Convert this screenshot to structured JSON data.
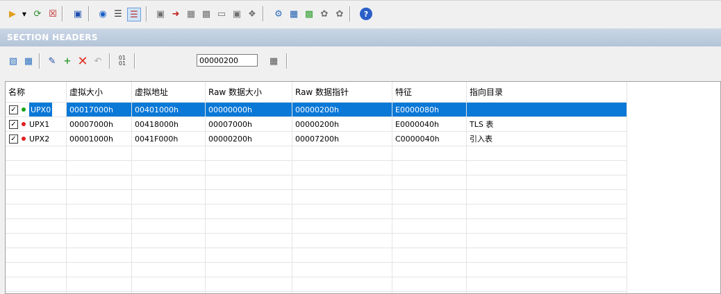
{
  "section_header": "SECTION HEADERS",
  "address_value": "00000200",
  "columns": [
    "名称",
    "虚拟大小",
    "虚拟地址",
    "Raw 数据大小",
    "Raw 数据指针",
    "特征",
    "指向目录"
  ],
  "rows": [
    {
      "name": "UPX0",
      "status_color": "#14a614",
      "vsize": "00017000h",
      "vaddr": "00401000h",
      "rsize": "00000000h",
      "rptr": "00000200h",
      "chars": "E0000080h",
      "dir": ""
    },
    {
      "name": "UPX1",
      "status_color": "#e02020",
      "vsize": "00007000h",
      "vaddr": "00418000h",
      "rsize": "00007000h",
      "rptr": "00000200h",
      "chars": "E0000040h",
      "dir": "TLS 表"
    },
    {
      "name": "UPX2",
      "status_color": "#e02020",
      "vsize": "00001000h",
      "vaddr": "0041F000h",
      "rsize": "00000200h",
      "rptr": "00007200h",
      "chars": "C0000040h",
      "dir": "引入表"
    }
  ],
  "toolbar1_icons": [
    "open-icon",
    "dropdown-arrow-icon",
    "refresh-icon",
    "close-file-icon",
    "save-icon",
    "info-icon",
    "tree-icon",
    "list-icon",
    "import-icon",
    "export-icon",
    "add-icon",
    "rebuild-icon",
    "copy-icon",
    "paste-icon",
    "move-icon",
    "settings-icon",
    "dependency-icon",
    "module-icon",
    "plugin-icon",
    "plugin2-icon",
    "help-icon"
  ],
  "toolbar2_icons": [
    "section-copy-icon",
    "section-paste-icon",
    "edit-section-icon",
    "add-section-icon",
    "delete-section-icon",
    "undo-icon",
    "binary-icon",
    "calculator-icon"
  ]
}
